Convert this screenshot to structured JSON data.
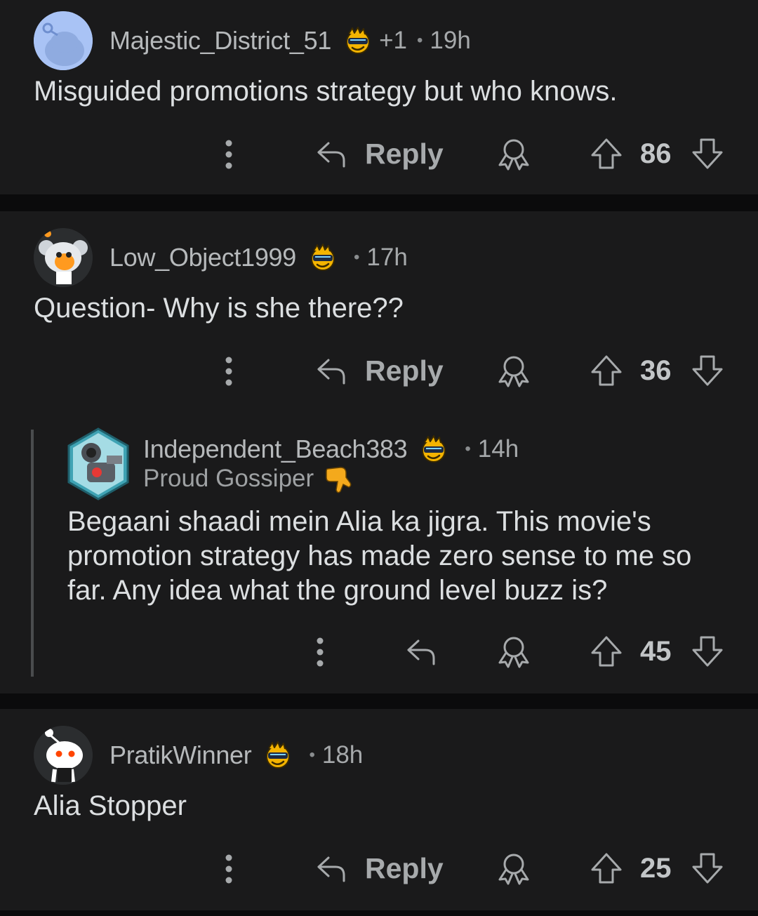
{
  "comments": [
    {
      "username": "Majestic_District_51",
      "flair_icon": "sunglasses-emoji-icon",
      "extra": "+1",
      "age": "19h",
      "body": "Misguided promotions strategy but who knows.",
      "reply_label": "Reply",
      "score": "86"
    },
    {
      "username": "Low_Object1999",
      "flair_icon": "sunglasses-emoji-icon",
      "age": "17h",
      "body": "Question- Why is she there??",
      "reply_label": "Reply",
      "score": "36",
      "reply": {
        "username": "Independent_Beach383",
        "flair_icon": "sunglasses-emoji-icon",
        "age": "14h",
        "user_flair": "Proud Gossiper",
        "user_flair_icon": "thumbs-down-emoji-icon",
        "body_lines": [
          "Begaani shaadi mein Alia ka jigra. This movie's",
          "promotion strategy has made zero sense to me so",
          "far. Any idea what the ground level buzz is?"
        ],
        "score": "45"
      }
    },
    {
      "username": "PratikWinner",
      "flair_icon": "sunglasses-emoji-icon",
      "age": "18h",
      "body": "Alia Stopper",
      "reply_label": "Reply",
      "score": "25"
    }
  ],
  "dot": "•",
  "colors": {
    "background": "#0b0b0c",
    "card": "#1a1a1b",
    "text": "#dcdfe1",
    "muted": "#a6a9ab",
    "icon": "#b0b3b5"
  }
}
